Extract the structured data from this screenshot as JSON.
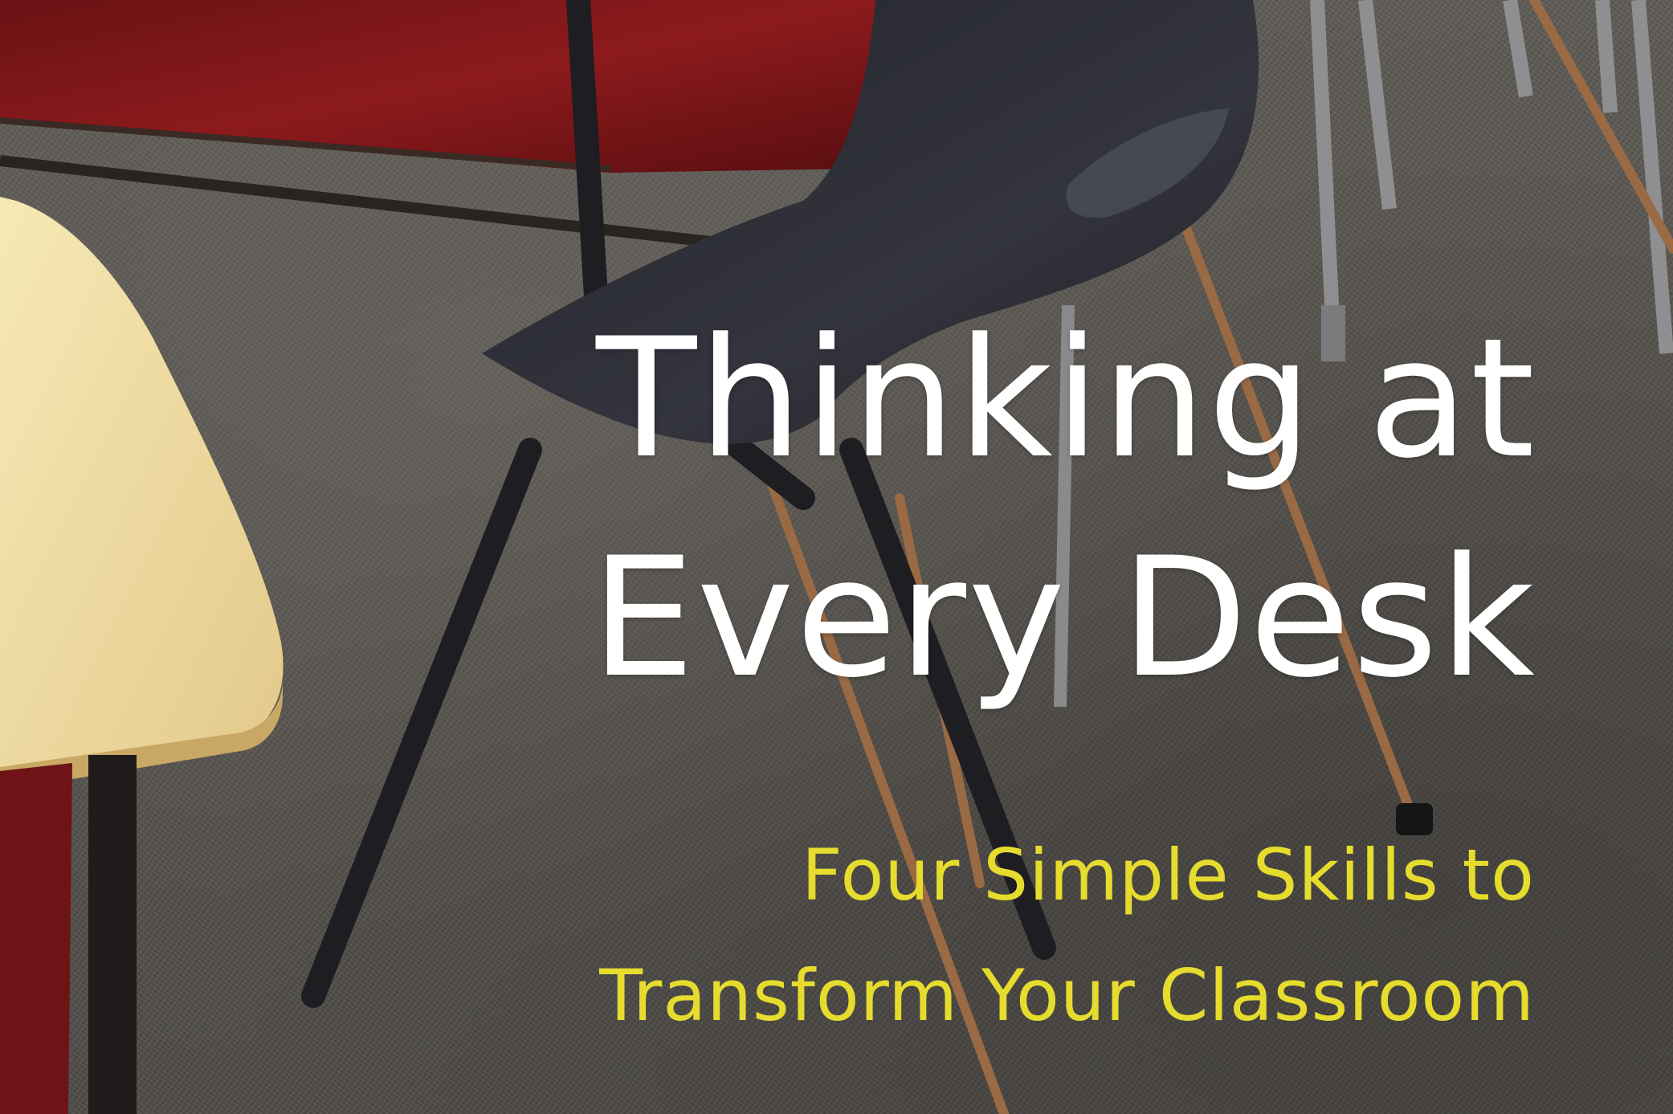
{
  "cover": {
    "title_line_1": "Thinking at",
    "title_line_2": "Every Desk",
    "subtitle_line_1": "Four Simple Skills to",
    "subtitle_line_2": "Transform Your Classroom"
  },
  "colors": {
    "title": "#ffffff",
    "subtitle": "#e6dc2e",
    "carpet": "#5d5a55",
    "chair_red": "#7a1416",
    "chair_seat": "#2c2d35",
    "desk_top": "#f3e3a6"
  }
}
